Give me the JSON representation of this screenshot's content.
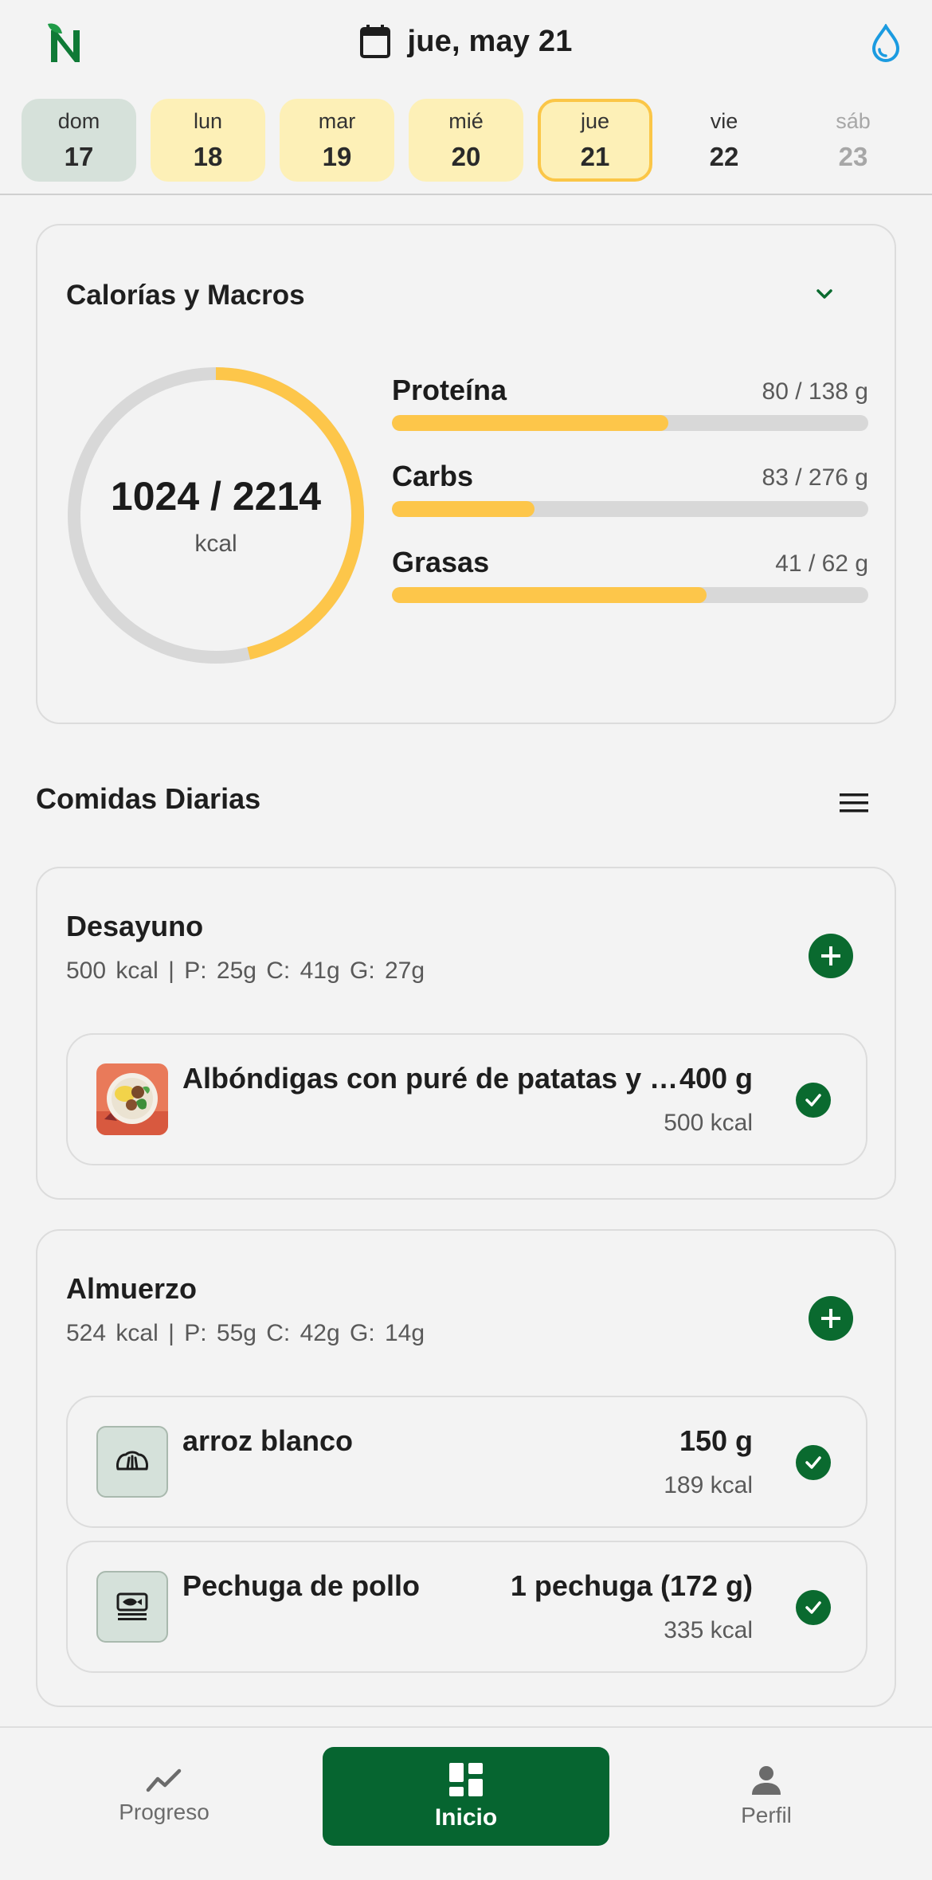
{
  "header": {
    "date_label": "jue, may 21",
    "icons": {
      "logo": "leaf-n-logo",
      "calendar": "calendar-icon",
      "water": "water-drop-icon"
    }
  },
  "days": [
    {
      "name": "dom",
      "num": "17",
      "state": "past"
    },
    {
      "name": "lun",
      "num": "18",
      "state": "logged"
    },
    {
      "name": "mar",
      "num": "19",
      "state": "logged"
    },
    {
      "name": "mié",
      "num": "20",
      "state": "logged"
    },
    {
      "name": "jue",
      "num": "21",
      "state": "today"
    },
    {
      "name": "vie",
      "num": "22",
      "state": "future"
    },
    {
      "name": "sáb",
      "num": "23",
      "state": "far"
    }
  ],
  "macros": {
    "title": "Calorías y Macros",
    "calories": {
      "text": "1024 / 2214",
      "unit": "kcal",
      "consumed": 1024,
      "goal": 2214
    },
    "items": [
      {
        "name": "Proteína",
        "value": "80 / 138 g",
        "fraction": 0.58
      },
      {
        "name": "Carbs",
        "value": "83 / 276 g",
        "fraction": 0.3
      },
      {
        "name": "Grasas",
        "value": "41 / 62 g",
        "fraction": 0.66
      }
    ]
  },
  "meals_section": {
    "title": "Comidas Diarias"
  },
  "meals": [
    {
      "title": "Desayuno",
      "summary": "500 kcal | P: 25g   C: 41g   G: 27g",
      "items": [
        {
          "name": "Albóndigas con puré de patatas y …",
          "qty": "400 g",
          "kcal": "500 kcal",
          "thumb": "photo"
        }
      ]
    },
    {
      "title": "Almuerzo",
      "summary": "524 kcal | P: 55g   C: 42g   G: 14g",
      "items": [
        {
          "name": "arroz blanco",
          "qty": "150 g",
          "kcal": "189 kcal",
          "thumb": "bread-icon"
        },
        {
          "name": "Pechuga de pollo",
          "qty": "1 pechuga (172 g)",
          "kcal": "335 kcal",
          "thumb": "fish-icon"
        }
      ]
    }
  ],
  "nav": {
    "items": [
      {
        "label": "Progreso",
        "icon": "trend-icon"
      },
      {
        "label": "Inicio",
        "icon": "dashboard-icon",
        "active": true
      },
      {
        "label": "Perfil",
        "icon": "person-icon"
      }
    ]
  },
  "colors": {
    "brand_green": "#0a6a2f",
    "accent_yellow": "#fdc64a",
    "today_bg": "#fdf0b7",
    "past_bg": "#d6e1da"
  }
}
